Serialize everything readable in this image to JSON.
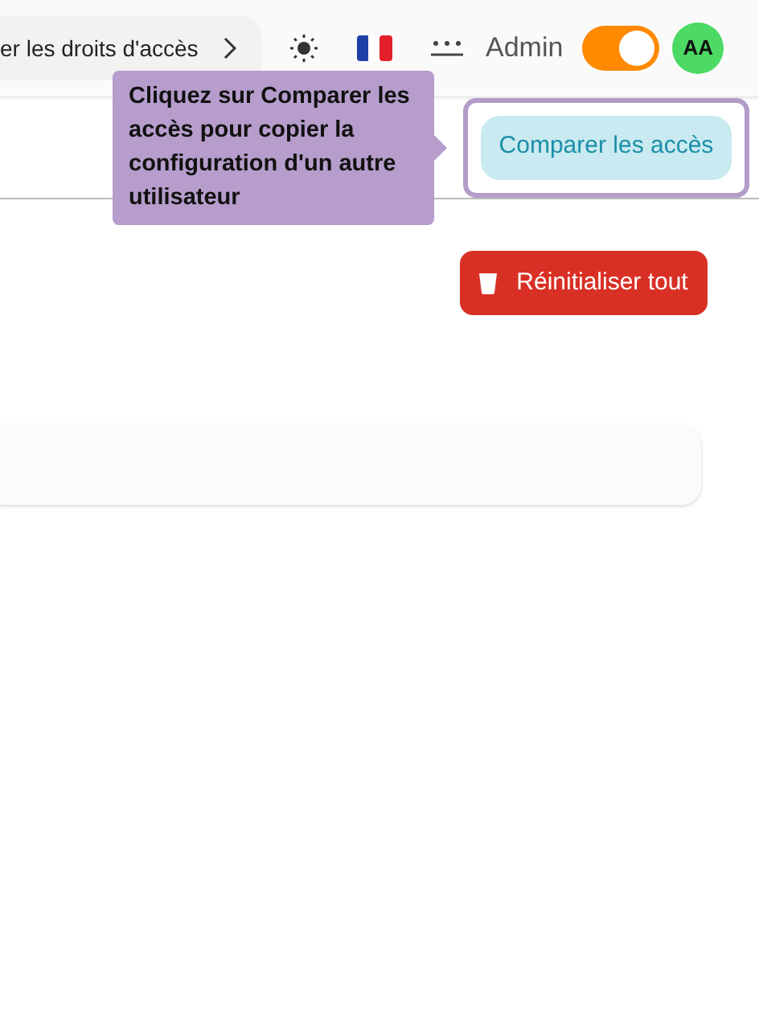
{
  "header": {
    "breadcrumb": "er les droits d'accès",
    "user_label": "Admin",
    "admin_mode": {
      "on": true
    },
    "avatar": "AA"
  },
  "tooltip": "Cliquez sur Comparer les accès pour copier la configuration d'un autre utilisateur",
  "compare_button": {
    "label": "Comparer les accès",
    "highlighted": true
  },
  "reset_button": "Réinitialiser tout"
}
